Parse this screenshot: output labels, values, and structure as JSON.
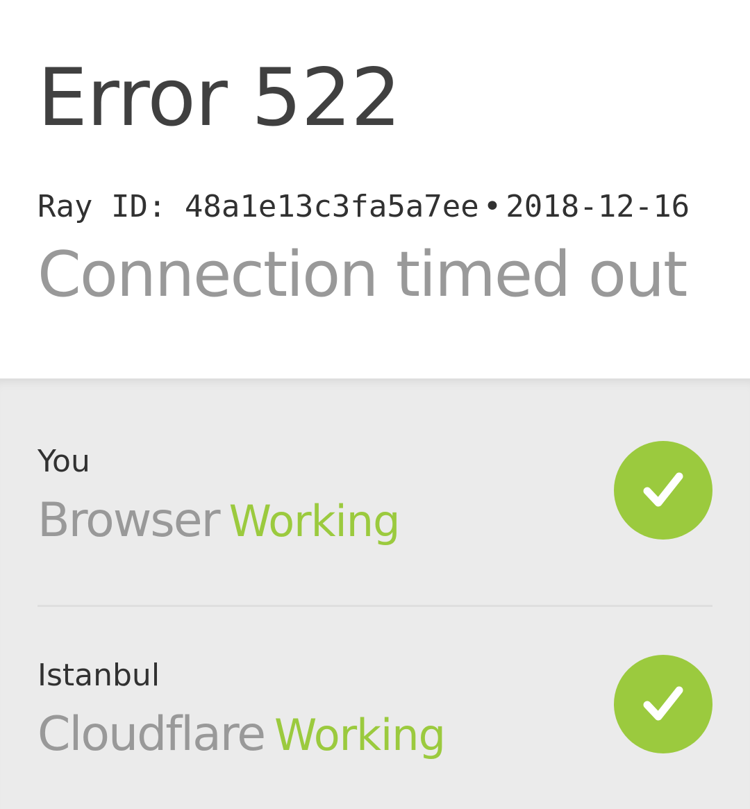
{
  "error": {
    "title": "Error 522",
    "ray_label": "Ray ID: 48a1e13c3fa5a7ee",
    "separator": "•",
    "date": "2018-12-16",
    "description": "Connection timed out"
  },
  "status": [
    {
      "location": "You",
      "name": "Browser",
      "state": "Working",
      "icon": "check-circle-icon"
    },
    {
      "location": "Istanbul",
      "name": "Cloudflare",
      "state": "Working",
      "icon": "check-circle-icon"
    }
  ],
  "colors": {
    "success": "#9bca3e",
    "panel_background": "#ebebeb",
    "title_text": "#404040",
    "muted_text": "#999999"
  }
}
